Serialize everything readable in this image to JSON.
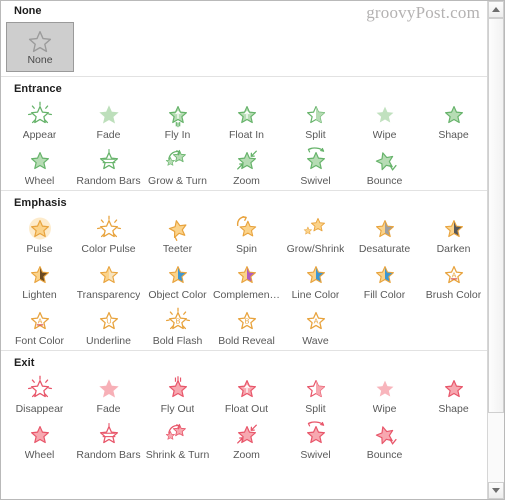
{
  "watermark": "groovyPost.com",
  "none_section": {
    "title": "None",
    "button_label": "None"
  },
  "colors": {
    "entrance": "#66b36a",
    "entrance_fill": "#b6dcb4",
    "emphasis": "#e8a33d",
    "emphasis_fill": "#fbd38b",
    "exit": "#e8566a",
    "exit_fill": "#f7a8b0",
    "none_star": "#9b9b9b",
    "none_bg": "#cecece",
    "label": "#595959",
    "heading": "#1d1d1d",
    "watermark": "#b4b2b2",
    "gray_half": "#9f9f9f",
    "dark_half": "#585858",
    "brown_half": "#6b4a22",
    "blue_half": "#3e97d1",
    "purple_half": "#b05bbf",
    "pale_half": "#f7e3bd"
  },
  "sections": [
    {
      "title": "Entrance",
      "rows": [
        [
          {
            "label": "Appear",
            "icon": "star-burst"
          },
          {
            "label": "Fade",
            "icon": "star-fade"
          },
          {
            "label": "Fly In",
            "icon": "star-arrow-up-trail"
          },
          {
            "label": "Float In",
            "icon": "star-arrow-up"
          },
          {
            "label": "Split",
            "icon": "star-split"
          },
          {
            "label": "Wipe",
            "icon": "star-wipe"
          },
          {
            "label": "Shape",
            "icon": "star-outline"
          }
        ],
        [
          {
            "label": "Wheel",
            "icon": "star-wheel"
          },
          {
            "label": "Random Bars",
            "icon": "star-bars"
          },
          {
            "label": "Grow & Turn",
            "icon": "star-grow-turn"
          },
          {
            "label": "Zoom",
            "icon": "star-zoom"
          },
          {
            "label": "Swivel",
            "icon": "star-swivel"
          },
          {
            "label": "Bounce",
            "icon": "star-bounce"
          }
        ]
      ]
    },
    {
      "title": "Emphasis",
      "rows": [
        [
          {
            "label": "Pulse",
            "icon": "star-glow"
          },
          {
            "label": "Color Pulse",
            "icon": "star-burst"
          },
          {
            "label": "Teeter",
            "icon": "star-teeter"
          },
          {
            "label": "Spin",
            "icon": "star-spin"
          },
          {
            "label": "Grow/Shrink",
            "icon": "star-grow-shrink"
          },
          {
            "label": "Desaturate",
            "icon": "star-half-gray"
          },
          {
            "label": "Darken",
            "icon": "star-half-dark"
          }
        ],
        [
          {
            "label": "Lighten",
            "icon": "star-half-brown"
          },
          {
            "label": "Transparency",
            "icon": "star-half-pale"
          },
          {
            "label": "Object Color",
            "icon": "star-half-blue"
          },
          {
            "label": "Complemen…",
            "icon": "star-half-purple"
          },
          {
            "label": "Line Color",
            "icon": "star-half-lineblue"
          },
          {
            "label": "Fill Color",
            "icon": "star-half-fillblue"
          },
          {
            "label": "Brush Color",
            "icon": "star-letter-a-underline"
          }
        ],
        [
          {
            "label": "Font Color",
            "icon": "star-letter-a-underline"
          },
          {
            "label": "Underline",
            "icon": "star-letter-u"
          },
          {
            "label": "Bold Flash",
            "icon": "star-letter-b-burst"
          },
          {
            "label": "Bold Reveal",
            "icon": "star-letter-b"
          },
          {
            "label": "Wave",
            "icon": "star-letter-a"
          }
        ]
      ]
    },
    {
      "title": "Exit",
      "rows": [
        [
          {
            "label": "Disappear",
            "icon": "star-burst"
          },
          {
            "label": "Fade",
            "icon": "star-fade"
          },
          {
            "label": "Fly Out",
            "icon": "star-fly-out"
          },
          {
            "label": "Float Out",
            "icon": "star-arrow-up"
          },
          {
            "label": "Split",
            "icon": "star-split"
          },
          {
            "label": "Wipe",
            "icon": "star-wipe"
          },
          {
            "label": "Shape",
            "icon": "star-outline"
          }
        ],
        [
          {
            "label": "Wheel",
            "icon": "star-wheel"
          },
          {
            "label": "Random Bars",
            "icon": "star-bars"
          },
          {
            "label": "Shrink & Turn",
            "icon": "star-grow-turn"
          },
          {
            "label": "Zoom",
            "icon": "star-zoom"
          },
          {
            "label": "Swivel",
            "icon": "star-swivel"
          },
          {
            "label": "Bounce",
            "icon": "star-bounce"
          }
        ]
      ]
    }
  ],
  "scrollbar": {
    "up_arrow": "scroll-up-arrow",
    "down_arrow": "scroll-down-arrow"
  }
}
